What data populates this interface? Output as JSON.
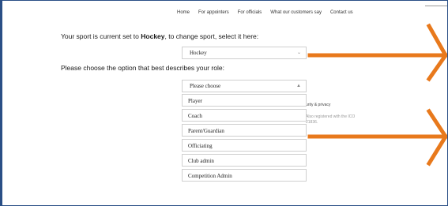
{
  "nav": {
    "items": [
      "Home",
      "For appointers",
      "For officials",
      "What our customers say",
      "Contact us"
    ]
  },
  "sport": {
    "prefix": "Your sport is current set to ",
    "name": "Hockey",
    "suffix": ", to change sport, select it here:",
    "selected": "Hockey"
  },
  "role": {
    "prompt": "Please choose the option that best describes your role:",
    "placeholder": "Please choose",
    "options": [
      "Player",
      "Coach",
      "Parent/Guardian",
      "Officiating",
      "Club admin",
      "Competition Admin"
    ]
  },
  "background_text": {
    "line1": "urity & privacy",
    "line2": "Also registered with the ICO",
    "line3": "21836."
  },
  "colors": {
    "frame": "#2a4f86",
    "arrow": "#e8791c"
  },
  "icons": {
    "dropdown_down": "chevron-down-icon",
    "dropdown_up": "chevron-up-icon",
    "annotation": "arrow-right-icon"
  }
}
